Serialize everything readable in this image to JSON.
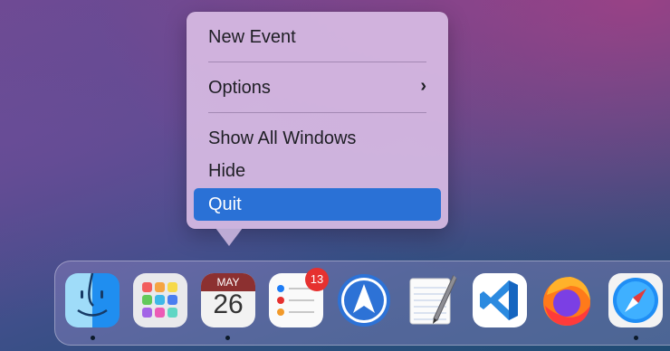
{
  "menu": {
    "items": [
      {
        "label": "New Event"
      },
      {
        "label": "Options"
      },
      {
        "label": "Show All Windows"
      },
      {
        "label": "Hide"
      },
      {
        "label": "Quit"
      }
    ],
    "selected": "Quit",
    "submenu_indicator": "›"
  },
  "dock": {
    "apps": [
      {
        "name": "Finder",
        "icon": "finder-icon",
        "running": true
      },
      {
        "name": "Launchpad",
        "icon": "launchpad-icon",
        "running": false
      },
      {
        "name": "Calendar",
        "icon": "calendar-icon",
        "running": true,
        "month": "MAY",
        "day": "26"
      },
      {
        "name": "Reminders",
        "icon": "reminders-icon",
        "running": false,
        "badge": "13"
      },
      {
        "name": "Spark",
        "icon": "spark-icon",
        "running": false
      },
      {
        "name": "TextEdit",
        "icon": "notepad-pen-icon",
        "running": false
      },
      {
        "name": "Visual Studio Code",
        "icon": "vscode-icon",
        "running": false
      },
      {
        "name": "Firefox",
        "icon": "firefox-icon",
        "running": false
      },
      {
        "name": "Safari",
        "icon": "safari-icon",
        "running": true
      }
    ]
  },
  "colors": {
    "selection": "#2a71d6",
    "badge": "#e6312f"
  }
}
